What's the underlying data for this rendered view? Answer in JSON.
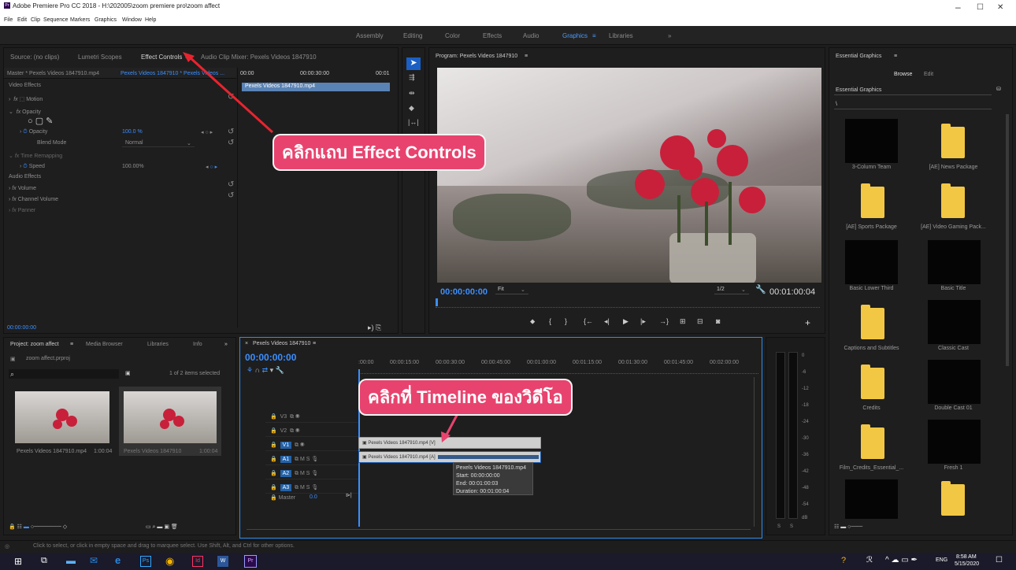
{
  "window": {
    "title": "Adobe Premiere Pro CC 2018 - H:\\202005\\zoom premiere pro\\zoom affect",
    "app_icon": "Pr",
    "minimize": "–",
    "maximize": "☐",
    "close": "✕"
  },
  "menu": [
    "File",
    "Edit",
    "Clip",
    "Sequence",
    "Markers",
    "Graphics",
    "Window",
    "Help"
  ],
  "workspaces": [
    "Assembly",
    "Editing",
    "Color",
    "Effects",
    "Audio",
    "Graphics",
    "Libraries",
    "»"
  ],
  "source_tabs": {
    "source": "Source: (no clips)",
    "lumetri": "Lumetri Scopes",
    "effect_controls": "Effect Controls",
    "mixer": "Audio Clip Mixer: Pexels Videos 1847910"
  },
  "effect_controls": {
    "master": "Master * Pexels Videos 1847910.mp4",
    "seq_clip": "Pexels Videos 1847910 * Pexels Videos ...",
    "t0": "00:00",
    "t1": "00:00:30:00",
    "t2": "00:01",
    "clip_label": "Pexels Videos 1847910.mp4",
    "video_effects": "Video Effects",
    "motion": "Motion",
    "opacity_group": "Opacity",
    "opacity": "Opacity",
    "opacity_val": "100.0 %",
    "blend_mode": "Blend Mode",
    "blend_val": "Normal",
    "time_remap": "Time Remapping",
    "speed": "Speed",
    "speed_val": "100.00%",
    "audio_effects": "Audio Effects",
    "volume": "Volume",
    "channel_volume": "Channel Volume",
    "panner": "Panner",
    "timecode": "00:00:00:00"
  },
  "program": {
    "title": "Program: Pexels Videos 1847910",
    "timecode": "00:00:00:00",
    "fit": "Fit",
    "resolution": "1/2",
    "duration": "00:01:00:04"
  },
  "essential_graphics": {
    "title": "Essential Graphics",
    "browse": "Browse",
    "edit": "Edit",
    "dropdown": "Essential Graphics",
    "path": "\\",
    "items": [
      "3-Column Team",
      "[AE] News Package",
      "[AE] Sports Package",
      "[AE] Video Gaming Pack...",
      "Basic Lower Third",
      "Basic Title",
      "Captions and Subtitles",
      "Classic Cast",
      "Credits",
      "Double Cast 01",
      "Film_Credits_Essential_...",
      "Fresh 1"
    ]
  },
  "project": {
    "tabs": [
      "Project: zoom affect",
      "Media Browser",
      "Libraries",
      "Info"
    ],
    "file": "zoom affect.prproj",
    "count": "1 of 2 items selected",
    "items": [
      {
        "name": "Pexels Videos 1847910.mp4",
        "dur": "1:00:04"
      },
      {
        "name": "Pexels Videos 1847910",
        "dur": "1:00:04"
      }
    ]
  },
  "timeline": {
    "tab": "Pexels Videos 1847910",
    "timecode": "00:00:00:00",
    "ruler": [
      ":00:00",
      "00:00:15:00",
      "00:00:30:00",
      "00:00:45:00",
      "00:01:00:00",
      "00:01:15:00",
      "00:01:30:00",
      "00:01:45:00",
      "00:02:00:00"
    ],
    "tracks": [
      "V3",
      "V2",
      "V1",
      "A1",
      "A2",
      "A3",
      "Master"
    ],
    "master_val": "0.0",
    "clip_v": "Pexels Videos 1847910.mp4 [V]",
    "clip_a": "Pexels Videos 1847910.mp4 [A]",
    "tooltip": [
      "Pexels Videos 1847910.mp4",
      "Start: 00:00:00:00",
      "End: 00:01:00:03",
      "Duration: 00:01:00:04"
    ]
  },
  "meter": {
    "scale": [
      "0",
      "-6",
      "-12",
      "-18",
      "-24",
      "-30",
      "-36",
      "-42",
      "-48",
      "-54",
      "dB"
    ],
    "s_left": "S",
    "s_right": "S"
  },
  "status": "Click to select, or click in empty space and drag to marquee select. Use Shift, Alt, and Ctrl for other options.",
  "callouts": {
    "top": "คลิกแถบ Effect Controls",
    "bottom": "คลิกที่ Timeline ของวิดีโอ"
  },
  "taskbar": {
    "time": "8:58 AM",
    "date": "5/15/2020",
    "lang": "ENG"
  }
}
